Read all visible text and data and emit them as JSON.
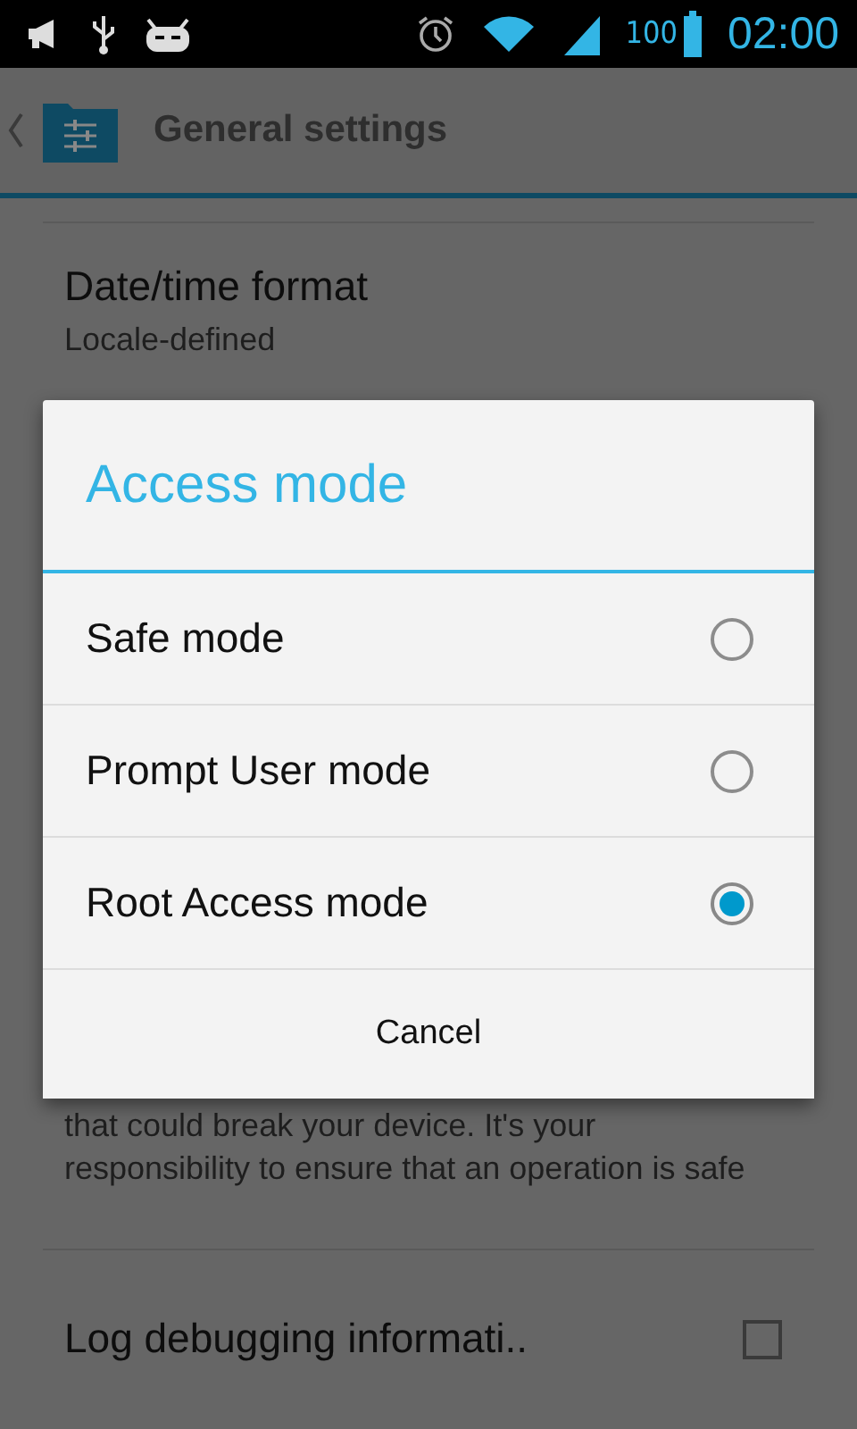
{
  "status_bar": {
    "battery_text": "100",
    "time": "02:00"
  },
  "action_bar": {
    "title": "General settings"
  },
  "settings": [
    {
      "kind": "text",
      "title": "Date/time format",
      "summary": "Locale-defined"
    },
    {
      "kind": "note",
      "lines": "that could break your device. It's your responsibility to ensure that an operation is safe"
    },
    {
      "kind": "checkbox",
      "title": "Log debugging informati..",
      "checked": false
    }
  ],
  "dialog": {
    "title": "Access mode",
    "options": [
      {
        "label": "Safe mode",
        "selected": false
      },
      {
        "label": "Prompt User mode",
        "selected": false
      },
      {
        "label": "Root Access mode",
        "selected": true
      }
    ],
    "cancel": "Cancel"
  }
}
